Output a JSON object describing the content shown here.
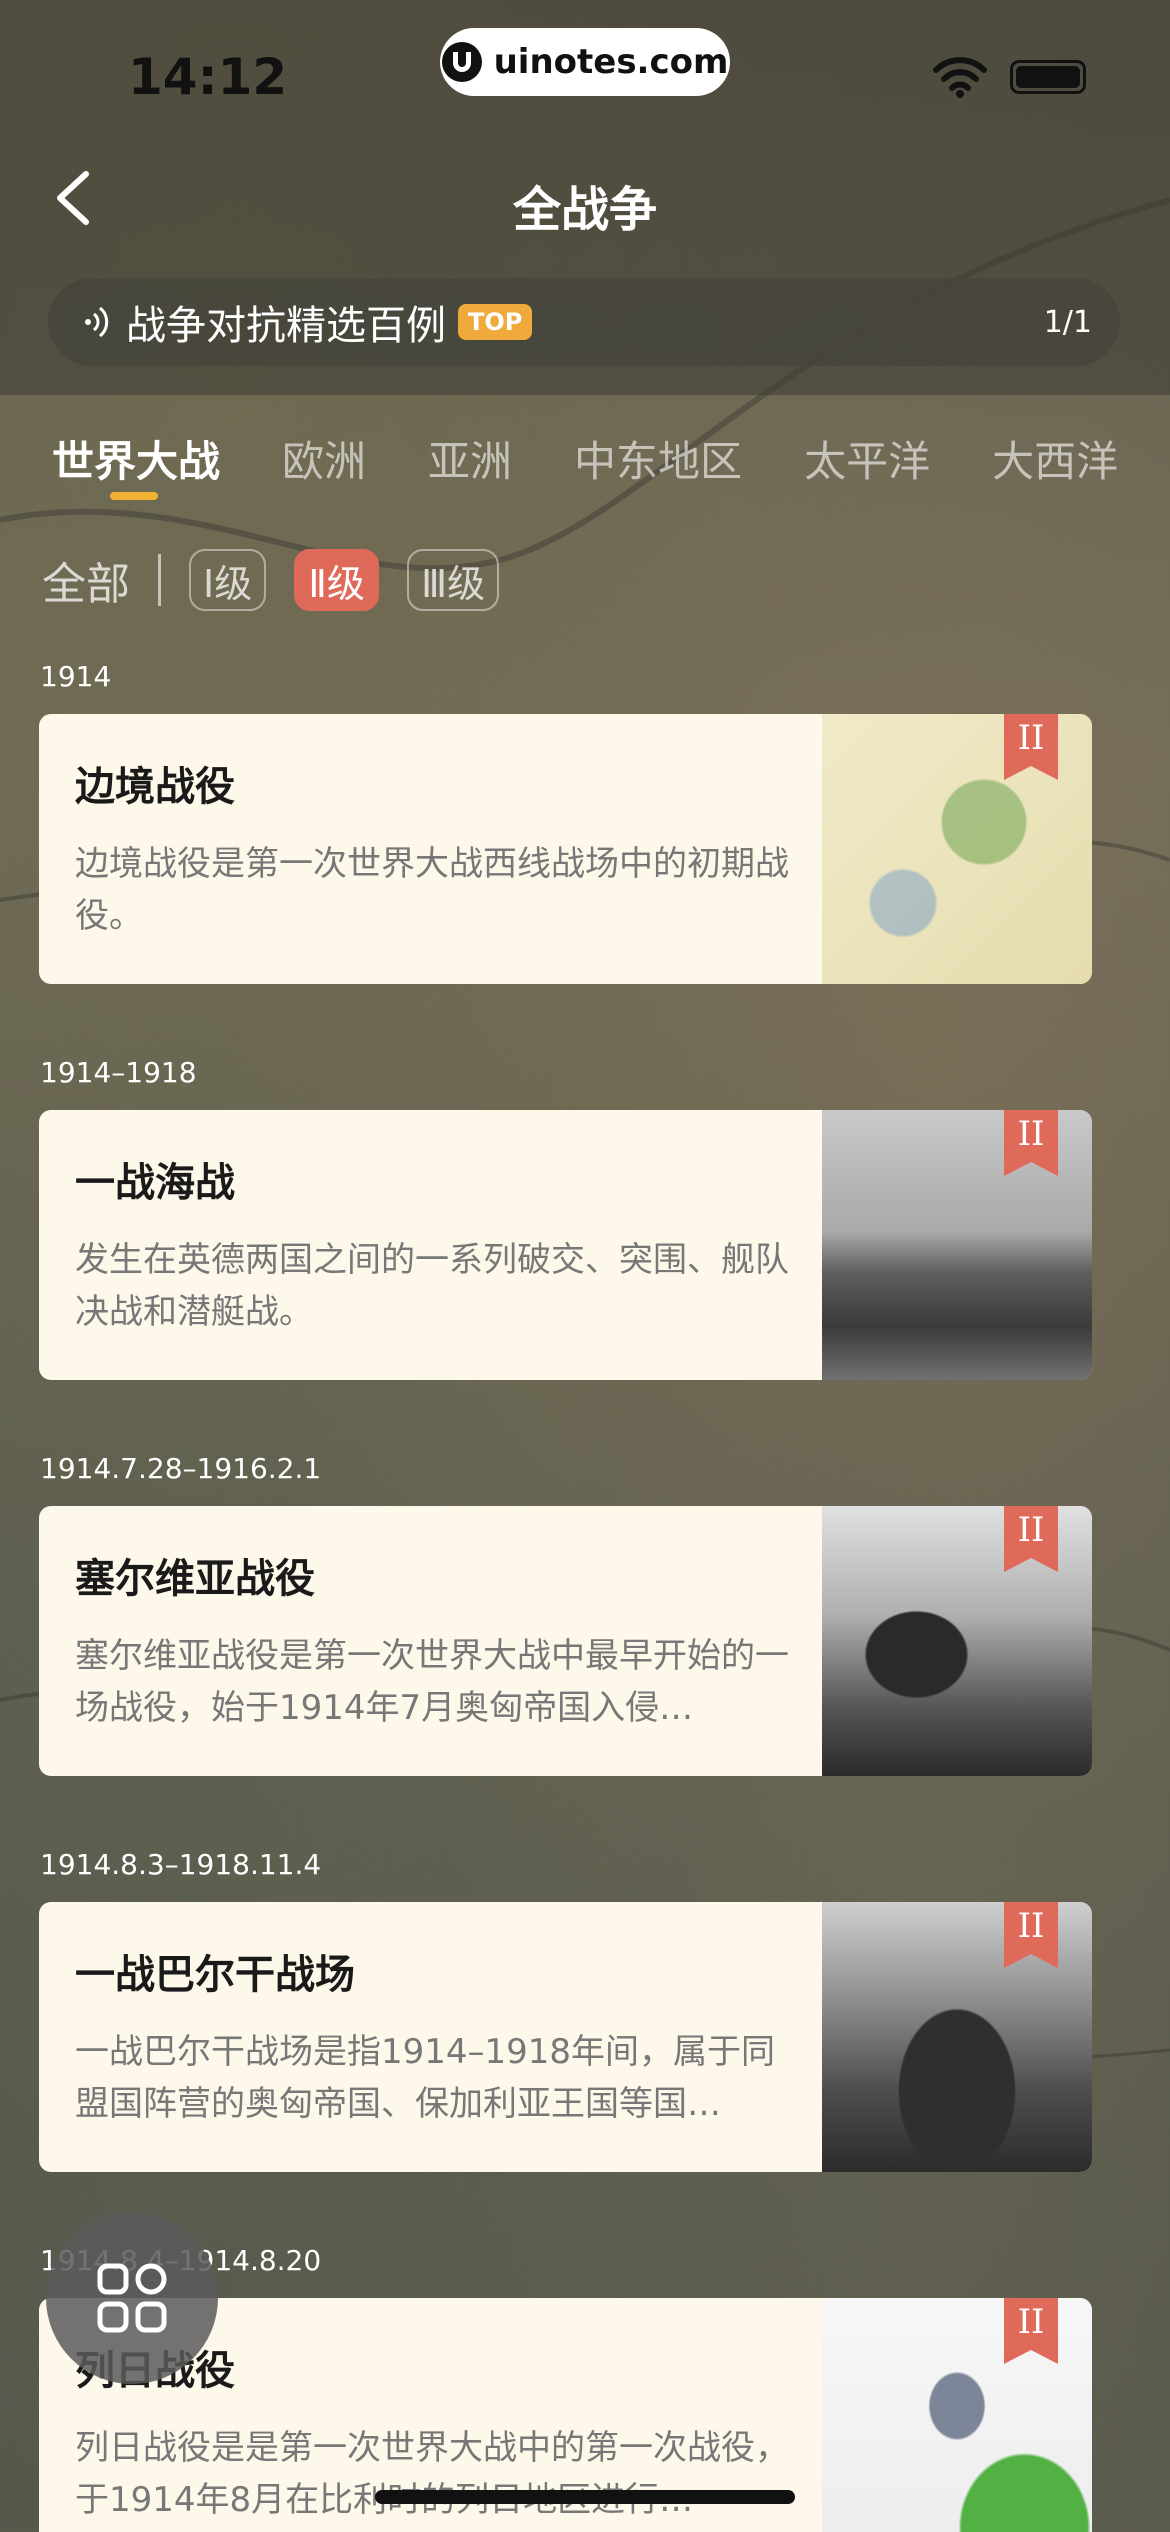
{
  "status_bar": {
    "time": "14:12",
    "url": "uinotes.com"
  },
  "header": {
    "title": "全战争"
  },
  "ticker": {
    "text": "战争对抗精选百例",
    "badge": "TOP",
    "page": "1/1"
  },
  "region_tabs": [
    "世界大战",
    "欧洲",
    "亚洲",
    "中东地区",
    "太平洋",
    "大西洋"
  ],
  "active_region_index": 0,
  "level_filter": {
    "all": "全部",
    "levels": [
      "Ⅰ级",
      "Ⅱ级",
      "Ⅲ级"
    ],
    "active_level_index": 1
  },
  "battles": [
    {
      "date": "1914",
      "title": "边境战役",
      "desc": "边境战役是第一次世界大战西线战场中的初期战役。",
      "level": "II",
      "image": "map"
    },
    {
      "date": "1914–1918",
      "title": "一战海战",
      "desc": "发生在英德两国之间的一系列破交、突围、舰队决战和潜艇战。",
      "level": "II",
      "image": "ship"
    },
    {
      "date": "1914.7.28–1916.2.1",
      "title": "塞尔维亚战役",
      "desc": "塞尔维亚战役是第一次世界大战中最早开始的一场战役，始于1914年7月奥匈帝国入侵…",
      "level": "II",
      "image": "soldier"
    },
    {
      "date": "1914.8.3–1918.11.4",
      "title": "一战巴尔干战场",
      "desc": "一战巴尔干战场是指1914–1918年间，属于同盟国阵营的奥匈帝国、保加利亚王国等国…",
      "level": "II",
      "image": "trench"
    },
    {
      "date": "1914.8.4–1914.8.20",
      "title": "列日战役",
      "desc": "列日战役是是第一次世界大战中的第一次战役，于1914年8月在比利时的列日地区进行…",
      "level": "II",
      "image": "map2"
    }
  ],
  "icons": {
    "back": "chevron-left-icon",
    "sound": "sound-wave-icon",
    "wifi": "wifi-icon",
    "battery": "battery-icon",
    "menu": "grid-menu-icon"
  },
  "colors": {
    "accent": "#f0b030",
    "active_level": "#e06a5a",
    "card": "#fdf8ea",
    "bookmark": "#e06a5a"
  }
}
